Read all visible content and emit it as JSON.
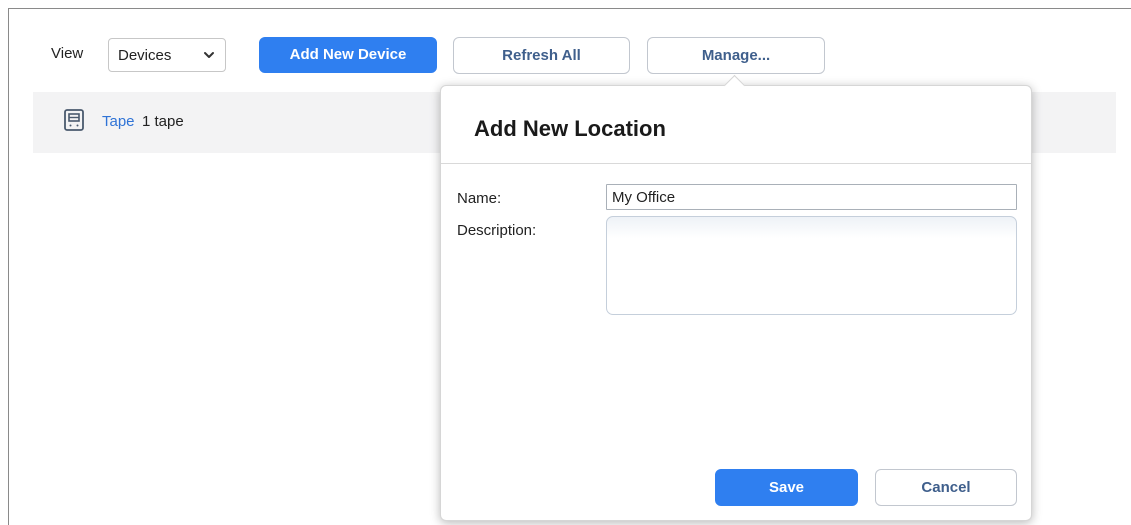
{
  "toolbar": {
    "view_label": "View",
    "view_select": {
      "value": "Devices"
    },
    "add_device_label": "Add New Device",
    "refresh_label": "Refresh All",
    "manage_label": "Manage..."
  },
  "device_list": [
    {
      "type_link": "Tape",
      "count_text": "1 tape",
      "icon": "tape-device-icon"
    }
  ],
  "dialog": {
    "title": "Add New Location",
    "name_label": "Name:",
    "name_value": "My Office",
    "description_label": "Description:",
    "description_value": "",
    "save_label": "Save",
    "cancel_label": "Cancel"
  },
  "colors": {
    "primary": "#2f7ff0",
    "link": "#2f73d6",
    "secondary_text": "#3f5f8c",
    "row_background": "#f3f3f4"
  }
}
